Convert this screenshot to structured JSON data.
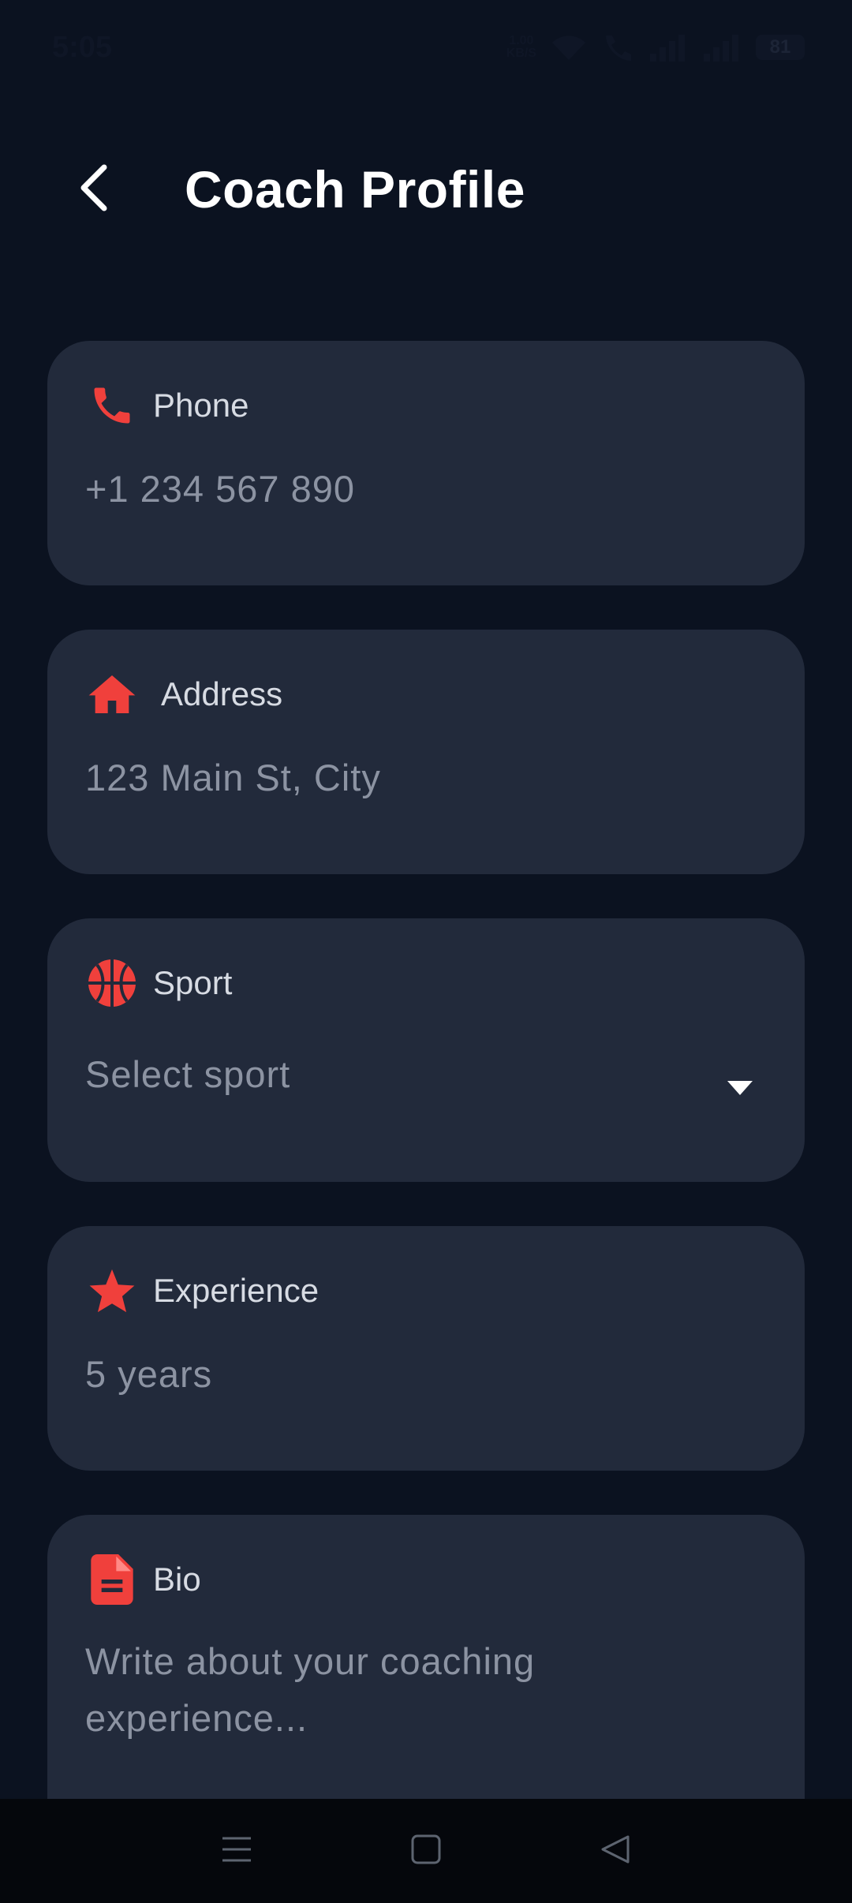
{
  "status_bar": {
    "time": "5:05",
    "net_speed_value": "1.00",
    "net_speed_unit": "KB/S",
    "battery": "81"
  },
  "header": {
    "title": "Coach Profile"
  },
  "fields": {
    "phone": {
      "label": "Phone",
      "value": "+1 234 567 890",
      "icon": "phone-icon"
    },
    "address": {
      "label": "Address",
      "value": "123 Main St, City",
      "icon": "home-icon"
    },
    "sport": {
      "label": "Sport",
      "value": "Select sport",
      "icon": "basketball-icon"
    },
    "experience": {
      "label": "Experience",
      "value": "5 years",
      "icon": "star-icon"
    },
    "bio": {
      "label": "Bio",
      "value_line1": "Write about your coaching",
      "value_line2": "experience...",
      "icon": "document-icon"
    }
  },
  "colors": {
    "accent": "#f0403c",
    "background": "#0b1220",
    "card": "#222a3b"
  },
  "nav": {
    "menu": "menu-icon",
    "home": "home-square-icon",
    "back": "back-triangle-icon"
  }
}
